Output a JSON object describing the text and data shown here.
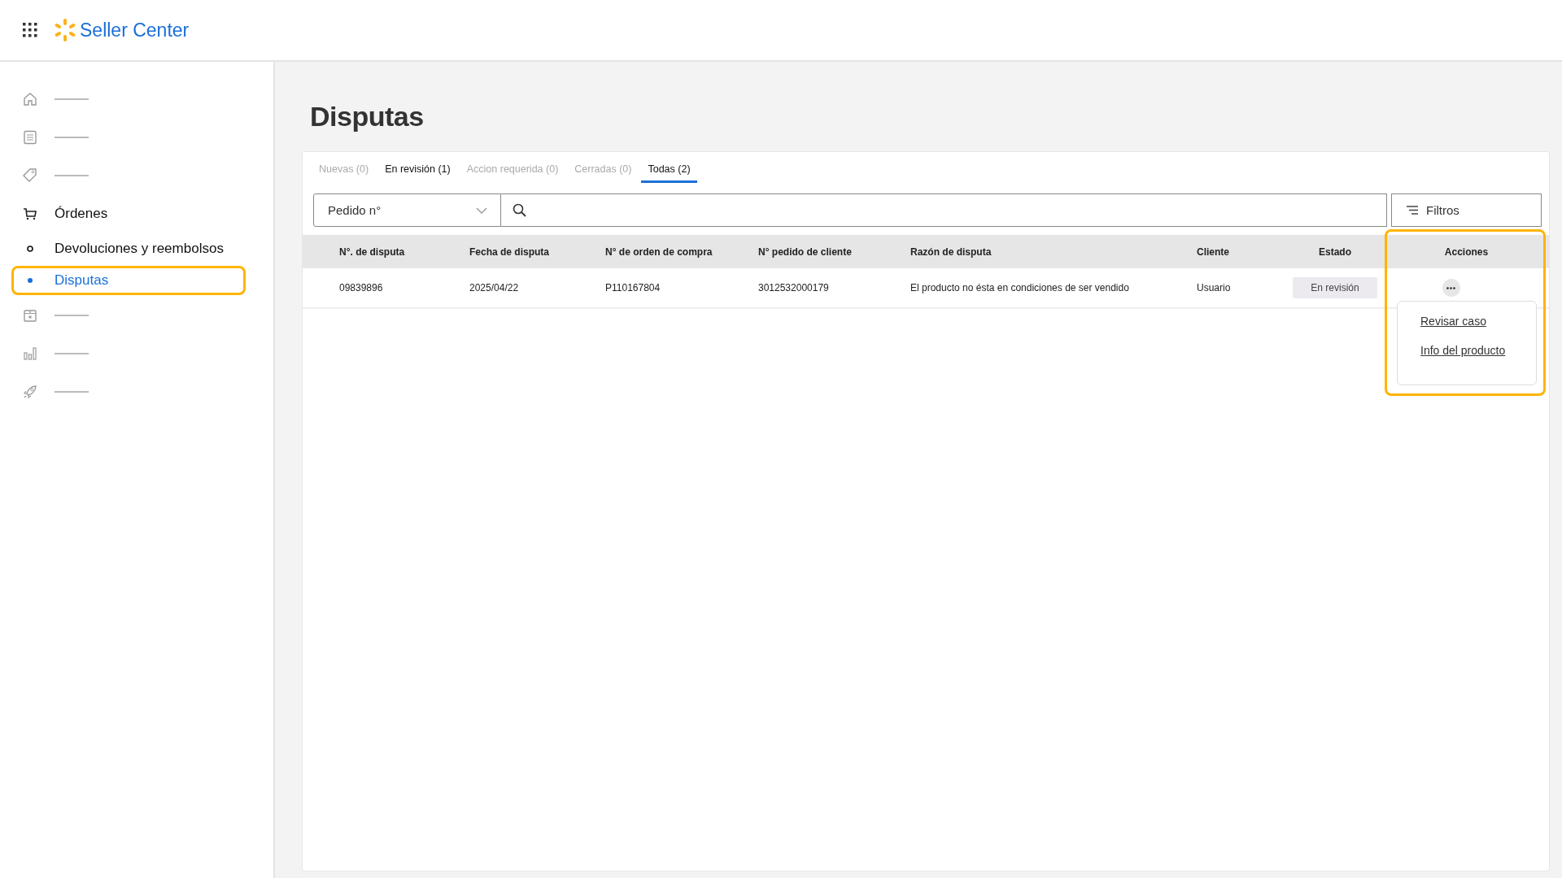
{
  "header": {
    "brand": "Seller Center"
  },
  "sidebar": {
    "items": [
      {
        "kind": "placeholder"
      },
      {
        "kind": "placeholder"
      },
      {
        "kind": "placeholder"
      },
      {
        "kind": "link",
        "label": "Órdenes",
        "children": [
          {
            "kind": "link",
            "label": "Devoluciones y reembolsos",
            "selected": false
          },
          {
            "kind": "link",
            "label": "Disputas",
            "selected": true,
            "highlighted": true
          }
        ]
      },
      {
        "kind": "placeholder"
      },
      {
        "kind": "placeholder"
      },
      {
        "kind": "placeholder"
      }
    ]
  },
  "page": {
    "title": "Disputas"
  },
  "tabs": [
    {
      "label": "Nuevas (0)",
      "selected": false,
      "disabled": true
    },
    {
      "label": "En revisión (1)",
      "selected": false,
      "disabled": false
    },
    {
      "label": "Accion requerida (0)",
      "selected": false,
      "disabled": true
    },
    {
      "label": "Cerradas (0)",
      "selected": false,
      "disabled": true
    },
    {
      "label": "Todas (2)",
      "selected": true,
      "disabled": false
    }
  ],
  "search": {
    "field_selector": "Pedido n°",
    "filters_button": "Filtros"
  },
  "table": {
    "columns": [
      {
        "label": "N°. de disputa"
      },
      {
        "label": "Fecha de disputa"
      },
      {
        "label": "N° de orden de compra"
      },
      {
        "label": "N° pedido de cliente"
      },
      {
        "label": "Razón de disputa"
      },
      {
        "label": "Cliente"
      },
      {
        "label": "Estado"
      },
      {
        "label": "Acciones",
        "highlighted": true
      }
    ],
    "rows": [
      {
        "cells": [
          "09839896",
          "2025/04/22",
          "P110167804",
          "3012532000179",
          "El producto no ésta en condiciones de ser vendido",
          "Usuario"
        ],
        "status": "En revisión",
        "menu_open": true,
        "menu": [
          "Revisar caso",
          "Info del producto"
        ]
      }
    ]
  }
}
